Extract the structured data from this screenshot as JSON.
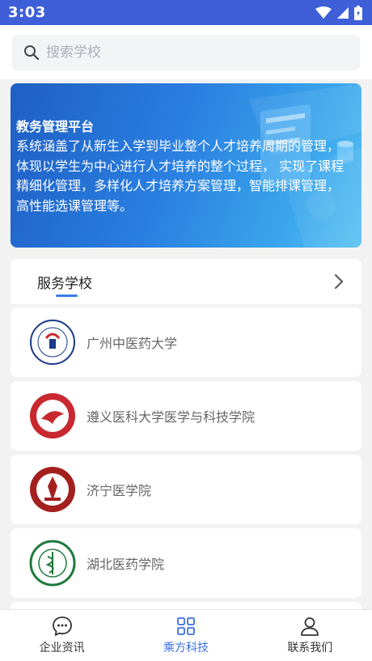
{
  "status": {
    "time": "3:03"
  },
  "search": {
    "placeholder": "搜索学校"
  },
  "banner": {
    "title": "教务管理平台",
    "text": "系统涵盖了从新生入学到毕业整个人才培养周期的管理，体现以学生为中心进行人才培养的整个过程， 实现了课程精细化管理，多样化人才培养方案管理，智能排课管理，高性能选课管理等。"
  },
  "section": {
    "title": "服务学校"
  },
  "schools": [
    {
      "name": "广州中医药大学",
      "logo_color": "#1a3a8a",
      "logo_icon": "school-emblem-icon"
    },
    {
      "name": "遵义医科大学医学与科技学院",
      "logo_color": "#c8282e",
      "logo_icon": "school-emblem-icon"
    },
    {
      "name": "济宁医学院",
      "logo_color": "#a3201f",
      "logo_icon": "school-emblem-icon"
    },
    {
      "name": "湖北医药学院",
      "logo_color": "#1e7a3c",
      "logo_icon": "school-emblem-icon"
    }
  ],
  "tabs": [
    {
      "label": "企业资讯",
      "icon": "chat-bubble-icon"
    },
    {
      "label": "乘方科技",
      "icon": "grid-apps-icon",
      "active": true
    },
    {
      "label": "联系我们",
      "icon": "person-icon"
    }
  ],
  "colors": {
    "status_bar": "#3f5fd8",
    "accent": "#3a6fe0"
  }
}
